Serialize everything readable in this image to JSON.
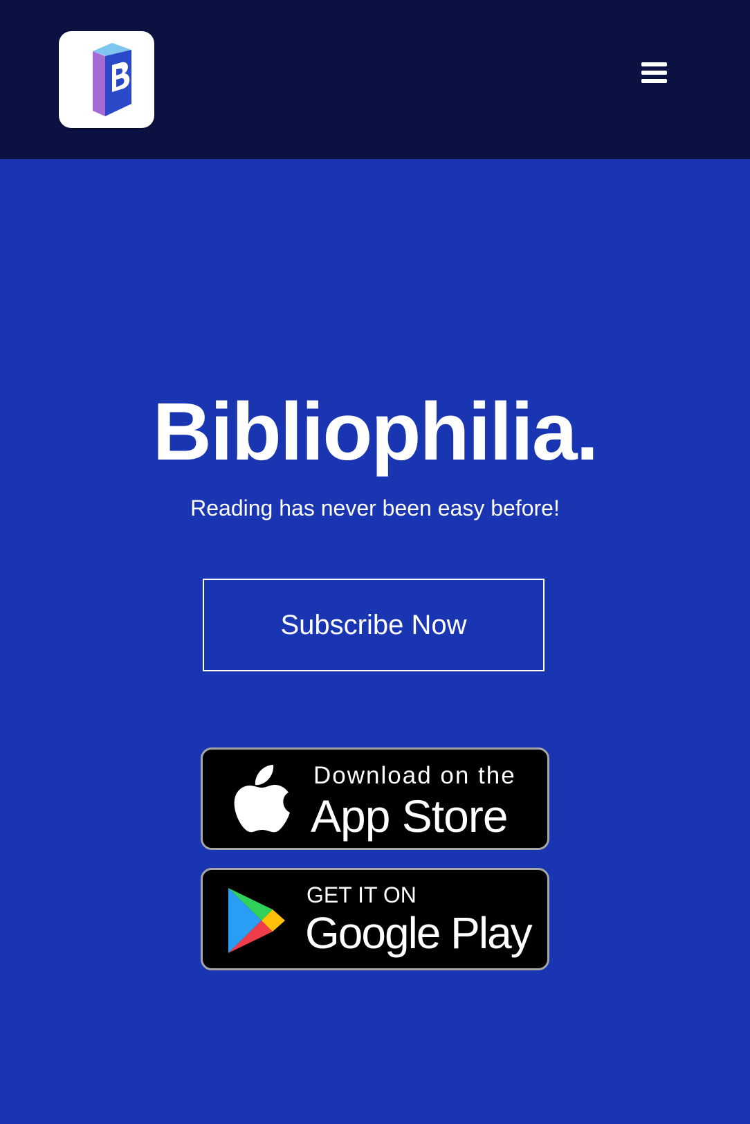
{
  "header": {
    "logo_icon": "bibliophilia-book-logo-icon",
    "menu_icon": "hamburger-menu-icon"
  },
  "hero": {
    "title": "Bibliophilia.",
    "subtitle": "Reading has never been easy before!",
    "subscribe_label": "Subscribe Now"
  },
  "badges": {
    "appstore": {
      "icon": "apple-icon",
      "small_text": "Download on the",
      "big_text": "App Store"
    },
    "googleplay": {
      "icon": "google-play-icon",
      "small_text": "GET IT ON",
      "big_text": "Google Play"
    }
  },
  "colors": {
    "header_bg": "#0b1241",
    "hero_bg": "#1a35b1",
    "text": "#ffffff",
    "badge_bg": "#000000",
    "badge_border": "#a6a6a6"
  }
}
